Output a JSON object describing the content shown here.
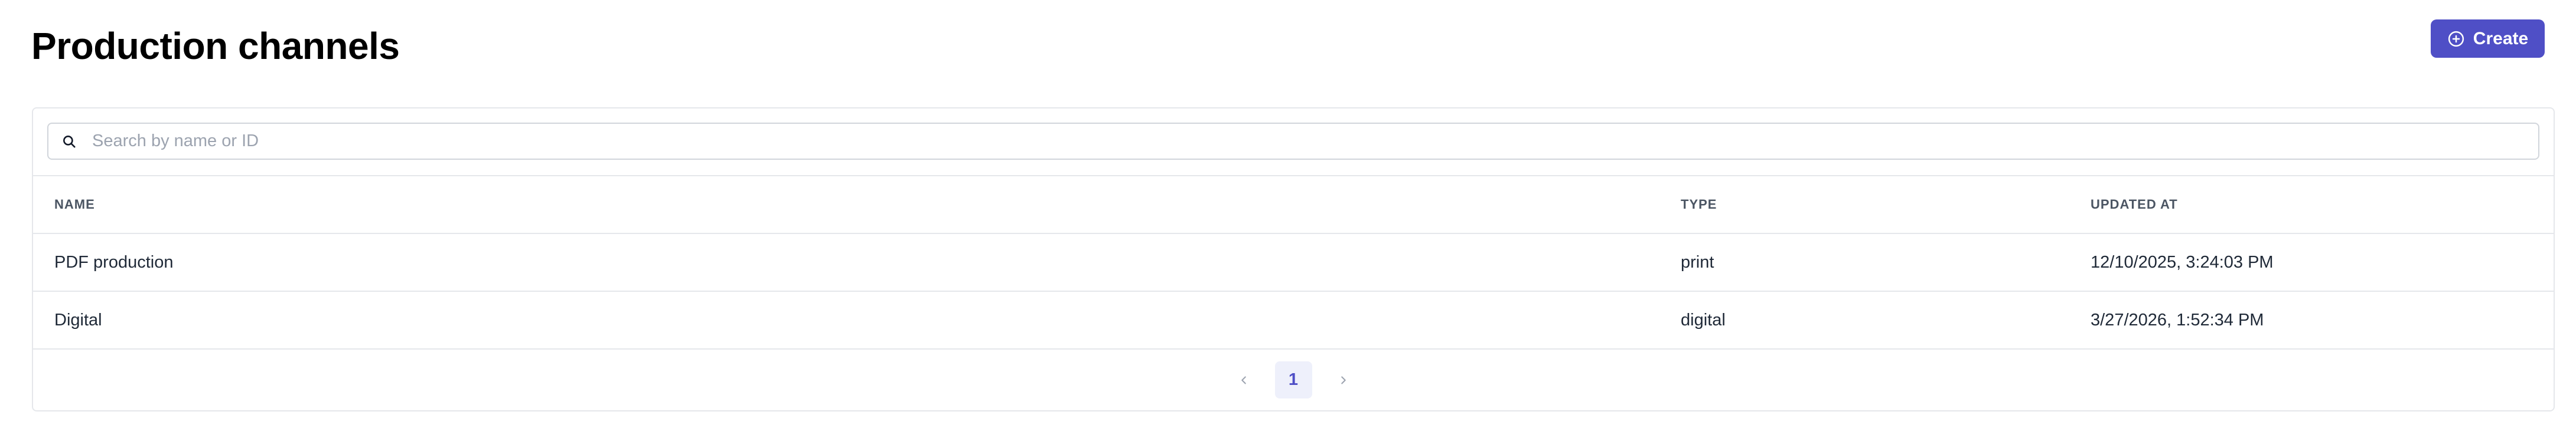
{
  "page": {
    "title": "Production channels"
  },
  "toolbar": {
    "create_label": "Create"
  },
  "search": {
    "placeholder": "Search by name or ID",
    "value": ""
  },
  "table": {
    "columns": [
      "NAME",
      "TYPE",
      "UPDATED AT"
    ],
    "rows": [
      {
        "name": "PDF production",
        "type": "print",
        "updated_at": "12/10/2025, 3:24:03 PM"
      },
      {
        "name": "Digital",
        "type": "digital",
        "updated_at": "3/27/2026, 1:52:34 PM"
      }
    ]
  },
  "pagination": {
    "current_page": "1"
  },
  "icons": {
    "create": "plus-circle-icon",
    "search": "search-icon",
    "prev": "chevron-left-icon",
    "next": "chevron-right-icon"
  },
  "colors": {
    "accent": "#4f4fc6",
    "page_bg": "#ffffff",
    "border": "#e5e7eb",
    "muted_text": "#9ca3af"
  }
}
